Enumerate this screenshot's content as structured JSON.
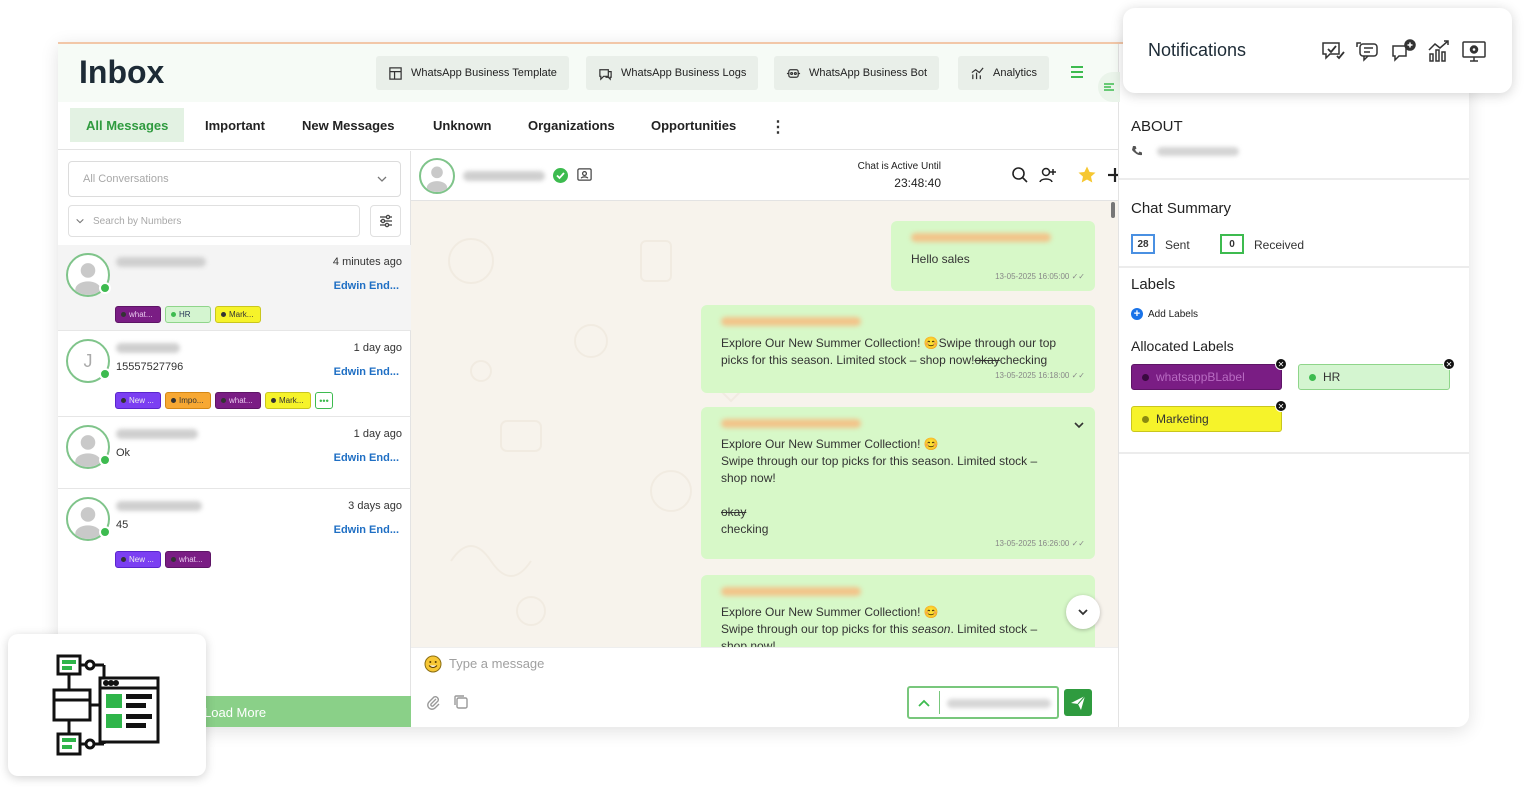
{
  "header": {
    "title": "Inbox",
    "buttons": [
      {
        "label": "WhatsApp Business Template",
        "icon": "template-icon"
      },
      {
        "label": "WhatsApp Business Logs",
        "icon": "logs-icon"
      },
      {
        "label": "WhatsApp Business Bot",
        "icon": "bot-icon"
      },
      {
        "label": "Analytics",
        "icon": "analytics-icon"
      }
    ]
  },
  "tabs": [
    "All Messages",
    "Important",
    "New Messages",
    "Unknown",
    "Organizations",
    "Opportunities"
  ],
  "active_tab": "All Messages",
  "filters": {
    "conversations_placeholder": "All Conversations",
    "search_placeholder": "Search by Numbers"
  },
  "conversations": [
    {
      "avatar_letter": "",
      "time": "4 minutes ago",
      "message": "",
      "owner": "Edwin End...",
      "chips": [
        {
          "label": "what...",
          "color": "purple"
        },
        {
          "label": "HR",
          "color": "green"
        },
        {
          "label": "Mark...",
          "color": "yellow"
        }
      ]
    },
    {
      "avatar_letter": "J",
      "time": "1 day ago",
      "message": "15557527796",
      "owner": "Edwin End...",
      "chips": [
        {
          "label": "New ...",
          "color": "violet"
        },
        {
          "label": "Impo...",
          "color": "orange"
        },
        {
          "label": "what...",
          "color": "purple"
        },
        {
          "label": "Mark...",
          "color": "yellow"
        },
        {
          "label": "•••",
          "color": "more"
        }
      ]
    },
    {
      "avatar_letter": "",
      "time": "1 day ago",
      "message": "Ok",
      "owner": "Edwin End...",
      "chips": []
    },
    {
      "avatar_letter": "",
      "time": "3 days ago",
      "message": "45",
      "owner": "Edwin End...",
      "chips": [
        {
          "label": "New ...",
          "color": "violet"
        },
        {
          "label": "what...",
          "color": "purple"
        }
      ]
    }
  ],
  "load_more": "Load More",
  "chat": {
    "active_label": "Chat is Active Until",
    "active_time": "23:48:40",
    "messages": [
      {
        "lines": [
          "Hello sales"
        ],
        "time": "13-05-2025 16:05:00"
      },
      {
        "line1": "Explore Our New Summer Collection! 😊Swipe through our top",
        "line2_a": "picks for this season. Limited stock – shop now!",
        "line2_strike": "okay",
        "line2_b": "checking",
        "time": "13-05-2025 16:18:00"
      },
      {
        "line1": "Explore Our New Summer Collection! 😊",
        "line2": "Swipe through our top picks for this season. Limited stock –",
        "line3": "shop now!",
        "line4_strike": "okay",
        "line5": "checking",
        "time": "13-05-2025 16:26:00"
      },
      {
        "line1": "Explore Our New Summer Collection! 😊",
        "line2_a": "Swipe through our top picks for this ",
        "line2_italic": "season",
        "line2_b": ". Limited stock –",
        "line3": "shop now!"
      }
    ],
    "composer_placeholder": "Type a message"
  },
  "sidebar": {
    "about_title": "ABOUT",
    "summary_title": "Chat Summary",
    "sent_count": "28",
    "sent_label": "Sent",
    "received_count": "0",
    "received_label": "Received",
    "labels_title": "Labels",
    "add_labels": "Add Labels",
    "allocated_title": "Allocated Labels",
    "allocated": [
      {
        "label": "whatsappBLabel",
        "bg": "#7a1d84",
        "fg": "#b86bc2",
        "dot": "#3a0a40"
      },
      {
        "label": "HR",
        "bg": "#d4f5d0",
        "fg": "#333333",
        "dot": "#3dbb4f"
      },
      {
        "label": "Marketing",
        "bg": "#f6f32a",
        "fg": "#333333",
        "dot": "#8a8a10"
      }
    ]
  },
  "notifications": {
    "title": "Notifications",
    "icons": [
      "chat-check-icon",
      "chat-bubbles-icon",
      "chat-add-icon",
      "chart-icon",
      "monitor-gear-icon"
    ]
  },
  "colors": {
    "accent": "#3dbb4f",
    "link": "#1f6fc4"
  }
}
